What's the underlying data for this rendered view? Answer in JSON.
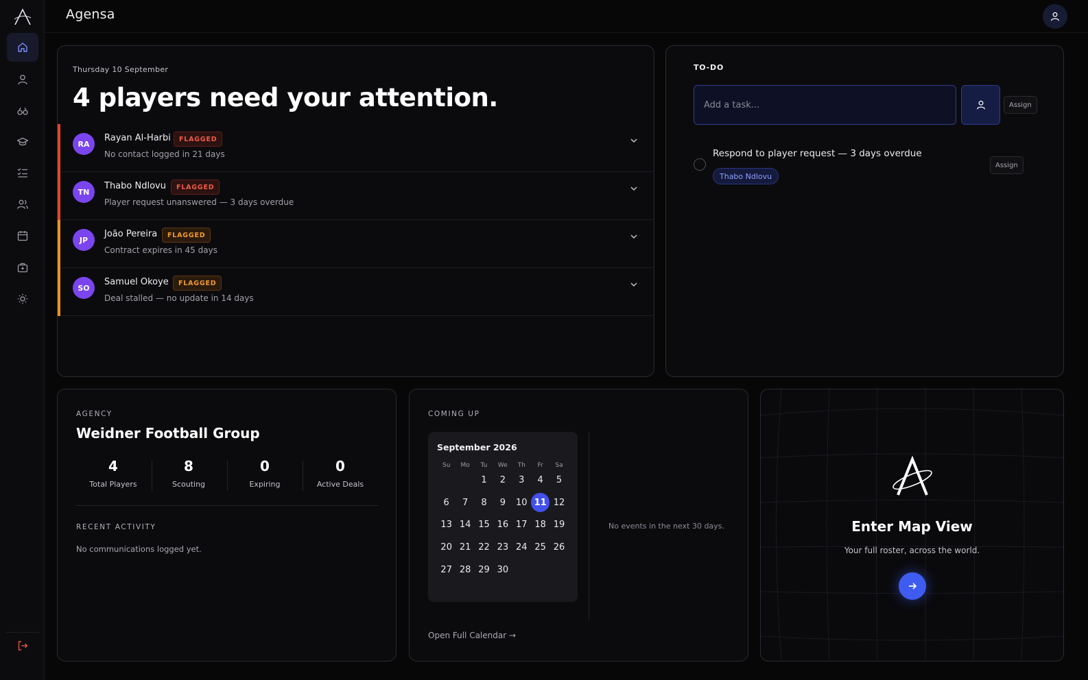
{
  "app": {
    "title": "Agensa"
  },
  "sidebar": {
    "items": [
      {
        "name": "home",
        "icon": "home-icon",
        "active": true
      },
      {
        "name": "players",
        "icon": "user-icon"
      },
      {
        "name": "scouting",
        "icon": "binoculars-icon"
      },
      {
        "name": "academy",
        "icon": "graduation-cap-icon"
      },
      {
        "name": "tasks",
        "icon": "checklist-icon"
      },
      {
        "name": "team",
        "icon": "users-icon"
      },
      {
        "name": "calendar",
        "icon": "calendar-icon"
      },
      {
        "name": "deals",
        "icon": "briefcase-icon"
      },
      {
        "name": "settings",
        "icon": "sun-icon"
      }
    ],
    "logout_icon": "logout-icon"
  },
  "attention": {
    "date": "Thursday 10 September",
    "headline": "4 players need your attention.",
    "players": [
      {
        "initials": "RA",
        "name": "Rayan Al-Harbi",
        "flag": "FLAGGED",
        "reason": "No contact logged in 21 days",
        "severity": "red"
      },
      {
        "initials": "TN",
        "name": "Thabo Ndlovu",
        "flag": "FLAGGED",
        "reason": "Player request unanswered — 3 days overdue",
        "severity": "red"
      },
      {
        "initials": "JP",
        "name": "João Pereira",
        "flag": "FLAGGED",
        "reason": "Contract expires in 45 days",
        "severity": "amber"
      },
      {
        "initials": "SO",
        "name": "Samuel Okoye",
        "flag": "FLAGGED",
        "reason": "Deal stalled — no update in 14 days",
        "severity": "amber"
      }
    ]
  },
  "todo": {
    "title": "TO-DO",
    "input_placeholder": "Add a task...",
    "assign_label": "Assign",
    "items": [
      {
        "text": "Respond to player request — 3 days overdue",
        "tag": "Thabo Ndlovu",
        "assign_label": "Assign"
      }
    ]
  },
  "agency": {
    "label": "AGENCY",
    "name": "Weidner Football Group",
    "stats": [
      {
        "value": "4",
        "label": "Total Players"
      },
      {
        "value": "8",
        "label": "Scouting"
      },
      {
        "value": "0",
        "label": "Expiring"
      },
      {
        "value": "0",
        "label": "Active Deals"
      }
    ],
    "recent_label": "RECENT ACTIVITY",
    "recent_empty": "No communications logged yet."
  },
  "coming_up": {
    "label": "COMING UP",
    "month": "September 2026",
    "dow": [
      "Su",
      "Mo",
      "Tu",
      "We",
      "Th",
      "Fr",
      "Sa"
    ],
    "weeks": [
      [
        "",
        "",
        "1",
        "2",
        "3",
        "4",
        "5"
      ],
      [
        "6",
        "7",
        "8",
        "9",
        "10",
        "11",
        "12"
      ],
      [
        "13",
        "14",
        "15",
        "16",
        "17",
        "18",
        "19"
      ],
      [
        "20",
        "21",
        "22",
        "23",
        "24",
        "25",
        "26"
      ],
      [
        "27",
        "28",
        "29",
        "30",
        "",
        "",
        ""
      ]
    ],
    "today": "11",
    "no_events": "No events in the next 30 days.",
    "open_calendar": "Open Full Calendar →"
  },
  "map": {
    "title": "Enter Map View",
    "subtitle": "Your full roster, across the world.",
    "go_icon": "arrow-right-icon"
  },
  "colors": {
    "accent": "#4350ec",
    "flag_red": "#f05a48",
    "flag_amber": "#f09a30",
    "avatar": "#7a45ee"
  }
}
